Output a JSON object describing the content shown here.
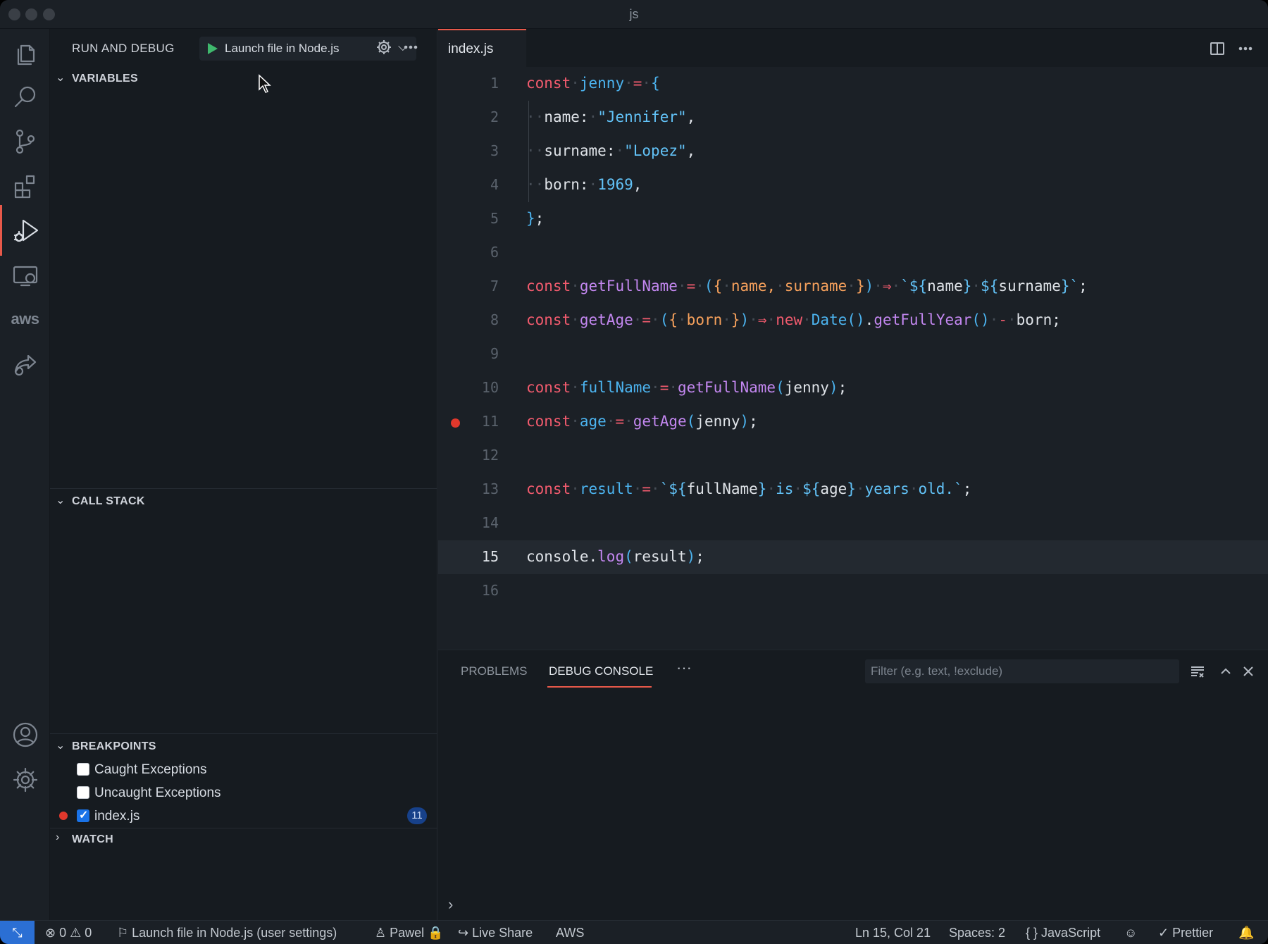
{
  "window": {
    "title": "js"
  },
  "activity": [
    "files-icon",
    "search-icon",
    "source-control-icon",
    "extensions-icon",
    "run-debug-icon",
    "remote-explorer-icon",
    "aws-icon",
    "live-share-icon",
    "account-icon",
    "settings-gear-icon"
  ],
  "aws_label": "aws",
  "sidebar": {
    "title": "RUN AND DEBUG",
    "launch_config": "Launch file in Node.js",
    "sections": {
      "variables": "VARIABLES",
      "call_stack": "CALL STACK",
      "breakpoints": "BREAKPOINTS",
      "watch": "WATCH"
    },
    "breakpoints": [
      {
        "label": "Caught Exceptions",
        "checked": false
      },
      {
        "label": "Uncaught Exceptions",
        "checked": false
      },
      {
        "label": "index.js",
        "checked": true,
        "badge": "11"
      }
    ]
  },
  "editor": {
    "tab": "index.js",
    "current_line": 15,
    "breakpoint_line": 11,
    "line_numbers": [
      "1",
      "2",
      "3",
      "4",
      "5",
      "6",
      "7",
      "8",
      "9",
      "10",
      "11",
      "12",
      "13",
      "14",
      "15",
      "16"
    ]
  },
  "panel": {
    "tabs": [
      "PROBLEMS",
      "DEBUG CONSOLE"
    ],
    "active_tab": "DEBUG CONSOLE",
    "more": "···",
    "filter_placeholder": "Filter (e.g. text, !exclude)",
    "prompt": "›"
  },
  "statusbar": {
    "errors": "0",
    "warnings": "0",
    "launch": "Launch file in Node.js (user settings)",
    "user": "Pawel",
    "live_share": "Live Share",
    "aws": "AWS",
    "position": "Ln 15, Col 21",
    "spaces": "Spaces: 2",
    "language": "JavaScript",
    "prettier": "Prettier"
  },
  "colors": {
    "accent": "#e8594a",
    "breakpoint": "#e0382c",
    "play": "#3fb86d",
    "badge": "#17418a"
  }
}
